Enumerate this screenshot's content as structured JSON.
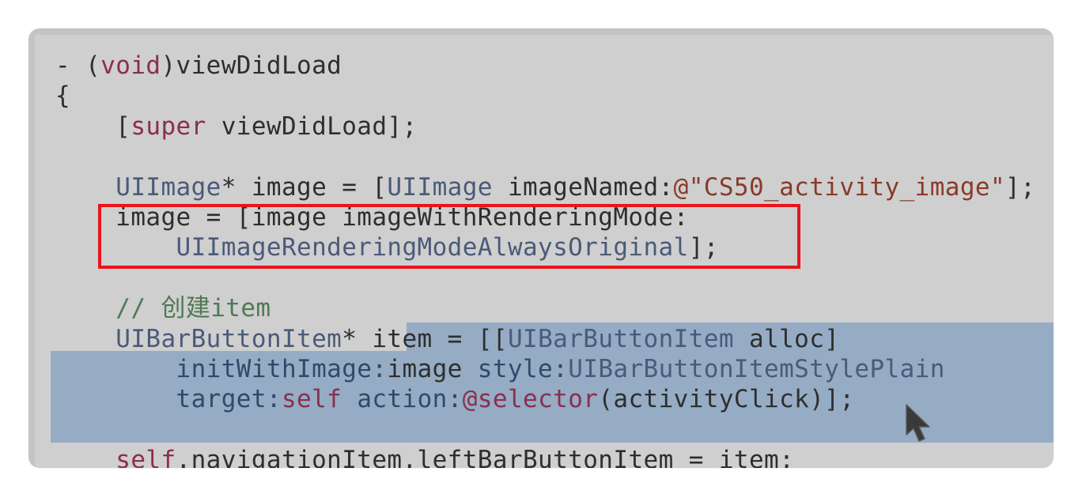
{
  "editor": {
    "lines": [
      {
        "parts": [
          {
            "t": "- (",
            "c": ""
          },
          {
            "t": "void",
            "c": "kw"
          },
          {
            "t": ")viewDidLoad",
            "c": ""
          }
        ]
      },
      {
        "parts": [
          {
            "t": "{",
            "c": ""
          }
        ]
      },
      {
        "parts": [
          {
            "t": "    [",
            "c": ""
          },
          {
            "t": "super",
            "c": "kw"
          },
          {
            "t": " viewDidLoad];",
            "c": ""
          }
        ]
      },
      {
        "parts": [
          {
            "t": "",
            "c": ""
          }
        ]
      },
      {
        "parts": [
          {
            "t": "    ",
            "c": ""
          },
          {
            "t": "UIImage",
            "c": "ty"
          },
          {
            "t": "* image = [",
            "c": ""
          },
          {
            "t": "UIImage",
            "c": "ty"
          },
          {
            "t": " imageNamed:",
            "c": ""
          },
          {
            "t": "@\"CS50_activity_image\"",
            "c": "str"
          },
          {
            "t": "];",
            "c": ""
          }
        ]
      },
      {
        "parts": [
          {
            "t": "    image = [image imageWithRenderingMode:",
            "c": ""
          }
        ]
      },
      {
        "parts": [
          {
            "t": "        ",
            "c": ""
          },
          {
            "t": "UIImageRenderingModeAlwaysOriginal",
            "c": "ty"
          },
          {
            "t": "];",
            "c": ""
          }
        ]
      },
      {
        "parts": [
          {
            "t": "",
            "c": ""
          }
        ]
      },
      {
        "parts": [
          {
            "t": "    // 创建item",
            "c": "cm"
          }
        ]
      },
      {
        "parts": [
          {
            "t": "    ",
            "c": ""
          },
          {
            "t": "UIBarButtonItem",
            "c": "ty"
          },
          {
            "t": "* item = [[",
            "c": ""
          },
          {
            "t": "UIBarButtonItem",
            "c": "ty"
          },
          {
            "t": " alloc]",
            "c": ""
          }
        ]
      },
      {
        "parts": [
          {
            "t": "        ",
            "c": ""
          },
          {
            "t": "initWithImage:",
            "c": "mth"
          },
          {
            "t": "image ",
            "c": ""
          },
          {
            "t": "style:",
            "c": "mth"
          },
          {
            "t": "UIBarButtonItemStylePlain",
            "c": "ty"
          }
        ]
      },
      {
        "parts": [
          {
            "t": "        ",
            "c": ""
          },
          {
            "t": "target:",
            "c": "mth"
          },
          {
            "t": "self",
            "c": "kw"
          },
          {
            "t": " ",
            "c": ""
          },
          {
            "t": "action:",
            "c": "mth"
          },
          {
            "t": "@selector",
            "c": "kw"
          },
          {
            "t": "(activityClick)];",
            "c": ""
          }
        ]
      },
      {
        "parts": [
          {
            "t": "",
            "c": ""
          }
        ]
      },
      {
        "parts": [
          {
            "t": "    ",
            "c": ""
          },
          {
            "t": "self",
            "c": "kw"
          },
          {
            "t": ".navigationItem.leftBarButtonItem = item;",
            "c": ""
          }
        ]
      }
    ]
  },
  "overlay": {
    "annotation_color": "#e8151b",
    "selection_color": "#95acc4",
    "cursor_icon": "arrow-pointer-icon"
  }
}
